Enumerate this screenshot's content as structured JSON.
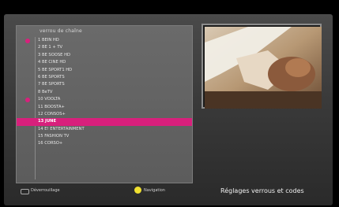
{
  "panel": {
    "title": "verrou de chaîne",
    "channels": [
      {
        "label": "1 BEIN HD",
        "locked": true
      },
      {
        "label": "2 BE 1 + TV",
        "locked": false
      },
      {
        "label": "3 BE SOOSE HD",
        "locked": false
      },
      {
        "label": "4 BE CINE HD",
        "locked": false
      },
      {
        "label": "5 BE SPORT1 HD",
        "locked": false
      },
      {
        "label": "6 BE SPORTS",
        "locked": false
      },
      {
        "label": "7 BE SPORTS",
        "locked": false
      },
      {
        "label": "8 BeTV",
        "locked": false
      },
      {
        "label": "10 VOOLTA",
        "locked": true
      },
      {
        "label": "11 BOOSTA+",
        "locked": false
      },
      {
        "label": "12 CONSOS+",
        "locked": false
      },
      {
        "label": "13 JUNE",
        "locked": false,
        "selected": true
      },
      {
        "label": "14 E! ENTERTAINMENT",
        "locked": false
      },
      {
        "label": "15 FASHION TV",
        "locked": false
      },
      {
        "label": "16 CORSO+",
        "locked": false
      }
    ]
  },
  "footer": {
    "blue_key_label": "Déverrouillage",
    "yellow_key_label": "Navigation",
    "title": "Réglages verrous et codes"
  },
  "colors": {
    "accent": "#d8207c",
    "yellow_key": "#f0e030"
  },
  "icons": {
    "lock": "lock-dot-icon",
    "blue_key": "blue-key-icon",
    "yellow_key": "yellow-key-icon"
  }
}
